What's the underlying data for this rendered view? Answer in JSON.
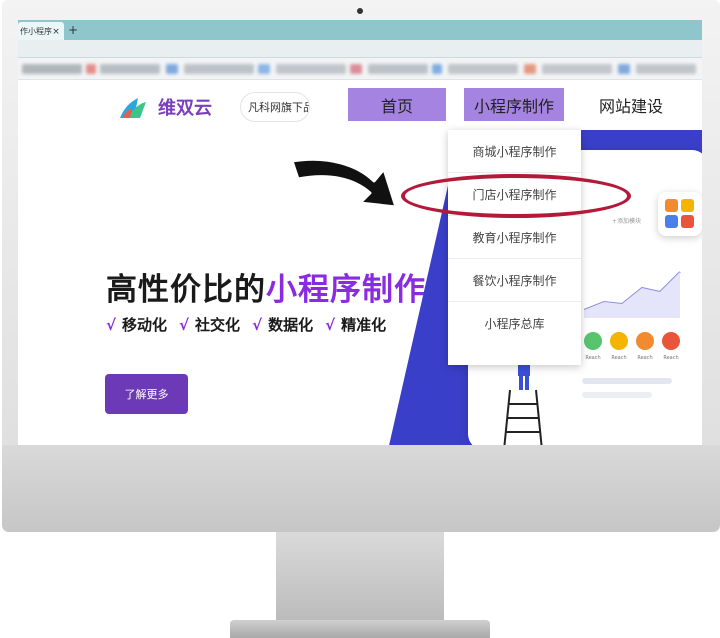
{
  "browser": {
    "tab_title": "作小程序",
    "tab_close": "×",
    "new_tab": "+"
  },
  "site": {
    "logo_text": "维双云",
    "brand_pill": "凡科网旗下品",
    "nav": {
      "home": "首页",
      "mini_program": "小程序制作",
      "website": "网站建设"
    },
    "dropdown": [
      "商城小程序制作",
      "门店小程序制作",
      "教育小程序制作",
      "餐饮小程序制作",
      "小程序总库"
    ],
    "hero": {
      "title_plain": "高性价比的",
      "title_accent": "小程序制作",
      "features": [
        "移动化",
        "社交化",
        "数据化",
        "精准化"
      ],
      "check_glyph": "√",
      "cta": "了解更多"
    },
    "illustration": {
      "add_module": "+添加模块",
      "reach_labels": [
        "Reach",
        "Reach",
        "Reach",
        "Reach"
      ]
    }
  },
  "colors": {
    "nav_active": "#a583e0",
    "accent_purple": "#8a2be2",
    "cta_bg": "#6c3ab6",
    "hero_blue": "#3a3fc9",
    "highlight_red": "#b31a3a",
    "tab_bar": "#8fc6cc"
  }
}
